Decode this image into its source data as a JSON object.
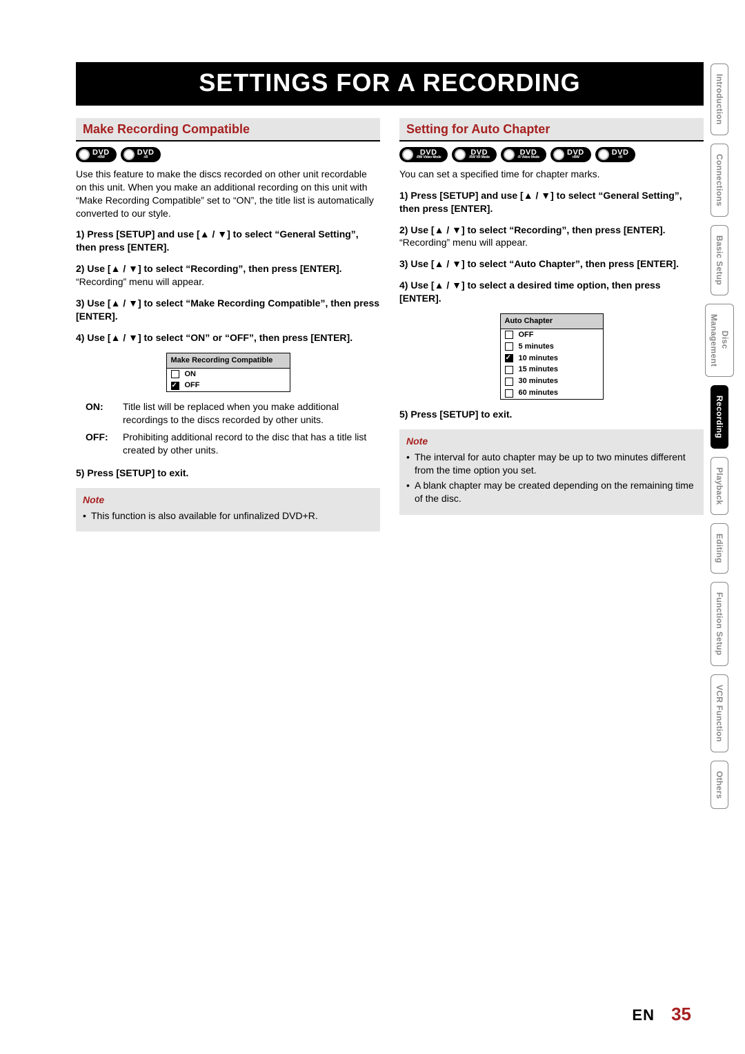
{
  "banner_title": "SETTINGS FOR A RECORDING",
  "sidetabs": [
    {
      "label": "Introduction",
      "active": false
    },
    {
      "label": "Connections",
      "active": false
    },
    {
      "label": "Basic Setup",
      "active": false
    },
    {
      "label": "Disc\nManagement",
      "active": false
    },
    {
      "label": "Recording",
      "active": true
    },
    {
      "label": "Playback",
      "active": false
    },
    {
      "label": "Editing",
      "active": false
    },
    {
      "label": "Function Setup",
      "active": false
    },
    {
      "label": "VCR Function",
      "active": false
    },
    {
      "label": "Others",
      "active": false
    }
  ],
  "left": {
    "heading": "Make Recording Compatible",
    "discs": [
      {
        "top": "DVD",
        "sub": "+RW"
      },
      {
        "top": "DVD",
        "sub": "+R"
      }
    ],
    "intro": "Use this feature to make the discs recorded on other unit recordable on this unit. When you make an additional recording on this unit with “Make Recording Compatible” set to “ON”, the title list is automatically converted to our style.",
    "steps": [
      {
        "bold": "1) Press [SETUP] and use [▲ / ▼] to select “General Setting”, then press [ENTER]."
      },
      {
        "bold": "2) Use [▲ / ▼] to select “Recording”, then press [ENTER].",
        "after": "“Recording” menu will appear."
      },
      {
        "bold": "3) Use [▲ / ▼] to select “Make Recording Compatible”, then press [ENTER]."
      },
      {
        "bold": "4) Use [▲ / ▼] to select “ON” or “OFF”, then press [ENTER]."
      }
    ],
    "menu": {
      "title": "Make Recording Compatible",
      "rows": [
        {
          "label": "ON",
          "checked": false
        },
        {
          "label": "OFF",
          "checked": true
        }
      ]
    },
    "defs": [
      {
        "label": "ON:",
        "desc": "Title list will be replaced when you make additional recordings to the discs recorded by other units."
      },
      {
        "label": "OFF:",
        "desc": "Prohibiting additional record to the disc that has a title list created by other units."
      }
    ],
    "step5": "5) Press [SETUP] to exit.",
    "note_title": "Note",
    "note_items": [
      "This function is also available for unfinalized DVD+R."
    ]
  },
  "right": {
    "heading": "Setting for Auto Chapter",
    "discs": [
      {
        "top": "DVD",
        "sub": "-RW Video Mode"
      },
      {
        "top": "DVD",
        "sub": "-RW VR Mode"
      },
      {
        "top": "DVD",
        "sub": "-R Video Mode"
      },
      {
        "top": "DVD",
        "sub": "+RW"
      },
      {
        "top": "DVD",
        "sub": "+R"
      }
    ],
    "intro": "You can set a specified time for chapter marks.",
    "steps": [
      {
        "bold": "1) Press [SETUP] and use [▲ / ▼] to select “General Setting”, then press [ENTER]."
      },
      {
        "bold": "2) Use [▲ / ▼] to select “Recording”, then press [ENTER].",
        "after": "“Recording” menu will appear."
      },
      {
        "bold": "3) Use [▲ / ▼] to select “Auto Chapter”, then press [ENTER]."
      },
      {
        "bold": "4) Use [▲ / ▼] to select a desired time option, then press [ENTER]."
      }
    ],
    "menu": {
      "title": "Auto Chapter",
      "rows": [
        {
          "label": "OFF",
          "checked": false
        },
        {
          "label": "5 minutes",
          "checked": false
        },
        {
          "label": "10 minutes",
          "checked": true
        },
        {
          "label": "15 minutes",
          "checked": false
        },
        {
          "label": "30 minutes",
          "checked": false
        },
        {
          "label": "60 minutes",
          "checked": false
        }
      ]
    },
    "step5": "5) Press [SETUP] to exit.",
    "note_title": "Note",
    "note_items": [
      "The interval for auto chapter may be up to two minutes different from the time option you set.",
      "A blank chapter may be created depending on the remaining time of the disc."
    ]
  },
  "footer": {
    "lang": "EN",
    "page": "35"
  }
}
